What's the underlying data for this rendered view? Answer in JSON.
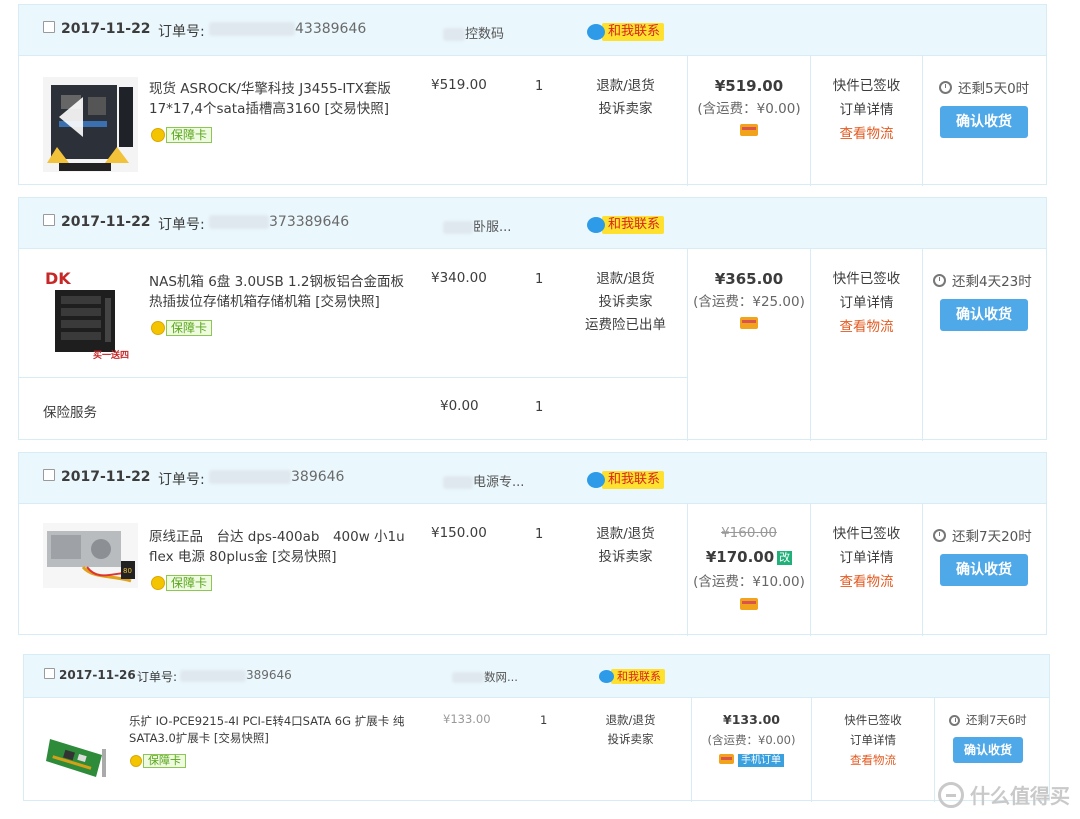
{
  "common": {
    "order_no_label": "订单号:",
    "contact_label": "和我联系",
    "refund_label": "退款/退货",
    "complain_label": "投诉卖家",
    "courier_signed_label": "快件已签收",
    "order_detail_label": "订单详情",
    "logistics_label": "查看物流",
    "confirm_label": "确认收货",
    "guarantee_label": "保障卡"
  },
  "orders": [
    {
      "date": "2017-11-22",
      "order_no_suffix": "43389646",
      "shop_suffix": "控数码",
      "item_title": "现货 ASROCK/华擎科技 J3455-ITX套版17*17,4个sata插槽高3160 [交易快照]",
      "unit_price": "¥519.00",
      "qty": "1",
      "total": "¥519.00",
      "shipping": "(含运费：¥0.00)",
      "remaining": "还剩5天0时"
    },
    {
      "date": "2017-11-22",
      "order_no_suffix": "373389646",
      "shop_suffix": "卧服...",
      "item_title": "NAS机箱 6盘 3.0USB 1.2钢板铝合金面板热插拔位存储机箱存储机箱 [交易快照]",
      "unit_price": "¥340.00",
      "qty": "1",
      "service_extra": "运费险已出单",
      "total": "¥365.00",
      "shipping": "(含运费：¥25.00)",
      "remaining": "还剩4天23时",
      "insurance_label": "保险服务",
      "insurance_price": "¥0.00",
      "insurance_qty": "1",
      "thumb_text": "买一送四"
    },
    {
      "date": "2017-11-22",
      "order_no_suffix": "389646",
      "shop_suffix": "电源专...",
      "item_title": "原线正品　台达 dps-400ab　400w 小1u flex 电源 80plus金 [交易快照]",
      "unit_price": "¥150.00",
      "qty": "1",
      "original_total": "¥160.00",
      "total": "¥170.00",
      "edit_label": "改",
      "shipping": "(含运费：¥10.00)",
      "remaining": "还剩7天20时"
    },
    {
      "date": "2017-11-26",
      "order_no_suffix": "389646",
      "shop_suffix": "数网...",
      "item_title": "乐扩 IO-PCE9215-4I PCI-E转4口SATA 6G 扩展卡 纯SATA3.0扩展卡 [交易快照]",
      "unit_price": "¥133.00",
      "qty": "1",
      "total": "¥133.00",
      "shipping": "(含运费：¥0.00)",
      "mobile_label": "手机订单",
      "remaining": "还剩7天6时"
    }
  ],
  "watermark": "什么值得买"
}
